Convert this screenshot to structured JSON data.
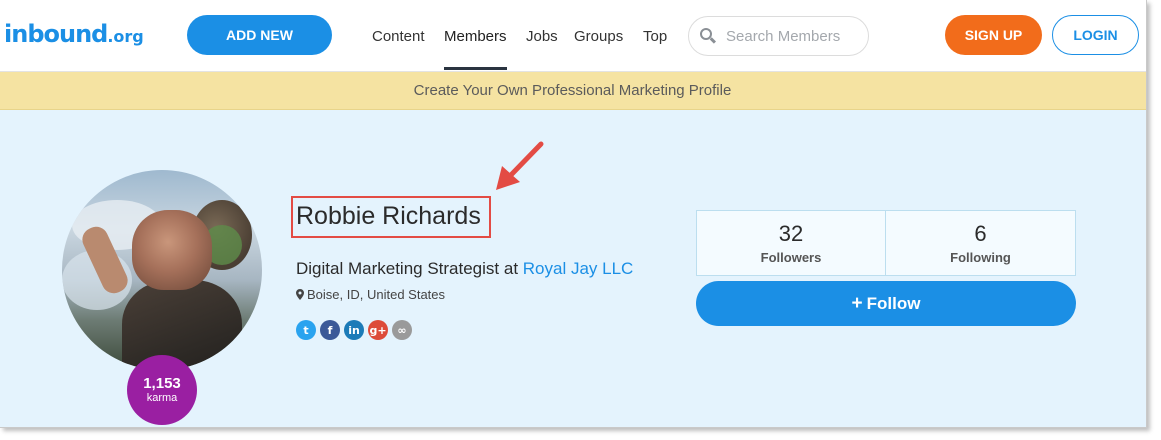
{
  "header": {
    "logo_main": "inbound",
    "logo_tld": ".org",
    "add_new_label": "ADD NEW",
    "nav": [
      "Content",
      "Members",
      "Jobs",
      "Groups",
      "Top"
    ],
    "active_nav": "Members",
    "search_placeholder": "Search Members",
    "signup_label": "SIGN UP",
    "login_label": "LOGIN"
  },
  "banner": {
    "text": "Create Your Own Professional Marketing Profile"
  },
  "profile": {
    "name": "Robbie Richards",
    "job_title": "Digital Marketing Strategist at ",
    "company": "Royal Jay LLC",
    "location": "Boise, ID, United States",
    "karma_value": "1,153",
    "karma_label": "karma",
    "socials": [
      {
        "name": "twitter-icon",
        "glyph": "t",
        "color": "#2aa3ef"
      },
      {
        "name": "facebook-icon",
        "glyph": "f",
        "color": "#3b5998"
      },
      {
        "name": "linkedin-icon",
        "glyph": "in",
        "color": "#1c7bb8"
      },
      {
        "name": "google-plus-icon",
        "glyph": "g+",
        "color": "#dd4b39"
      },
      {
        "name": "link-icon",
        "glyph": "∞",
        "color": "#9a9a9a"
      }
    ]
  },
  "stats": {
    "followers_count": "32",
    "followers_label": "Followers",
    "following_count": "6",
    "following_label": "Following"
  },
  "follow_label": "Follow",
  "colors": {
    "brand_blue": "#1b8fe5",
    "signup_orange": "#f26c1b",
    "karma_purple": "#9a1fa2",
    "banner_yellow": "#f5e3a2",
    "profile_bg": "#e4f3fd",
    "annotation_red": "#e34b44"
  }
}
